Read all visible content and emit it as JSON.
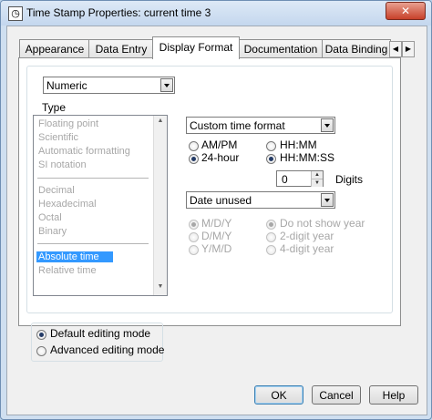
{
  "window": {
    "title": "Time Stamp Properties: current time 3",
    "close_glyph": "✕",
    "app_icon": "clock-icon"
  },
  "tabs": [
    {
      "label": "Appearance"
    },
    {
      "label": "Data Entry"
    },
    {
      "label": "Display Format",
      "active": true
    },
    {
      "label": "Documentation"
    },
    {
      "label": "Data Binding"
    }
  ],
  "tab_scroll": {
    "left": "◀",
    "right": "▶"
  },
  "format": {
    "category_value": "Numeric",
    "type_label": "Type",
    "type_list": [
      {
        "label": "Floating point"
      },
      {
        "label": "Scientific"
      },
      {
        "label": "Automatic formatting"
      },
      {
        "label": "SI notation"
      },
      {
        "label": "Decimal"
      },
      {
        "label": "Hexadecimal"
      },
      {
        "label": "Octal"
      },
      {
        "label": "Binary"
      },
      {
        "label": "Absolute time",
        "selected": true
      },
      {
        "label": "Relative time"
      }
    ],
    "time_format_value": "Custom time format",
    "time_options": {
      "am_pm": "AM/PM",
      "h24": "24-hour",
      "hh_mm": "HH:MM",
      "hh_mm_ss": "HH:MM:SS",
      "selected_clock": "24-hour",
      "selected_precision": "HH:MM:SS"
    },
    "digits": {
      "value": "0",
      "label": "Digits"
    },
    "date_format_value": "Date unused",
    "date_options": {
      "mdy": "M/D/Y",
      "dmy": "D/M/Y",
      "ymd": "Y/M/D",
      "no_year": "Do not show year",
      "two_digit": "2-digit year",
      "four_digit": "4-digit year"
    }
  },
  "editing_mode": {
    "default_label": "Default editing mode",
    "advanced_label": "Advanced editing mode",
    "selected": "Default editing mode"
  },
  "buttons": {
    "ok": "OK",
    "cancel": "Cancel",
    "help": "Help"
  }
}
